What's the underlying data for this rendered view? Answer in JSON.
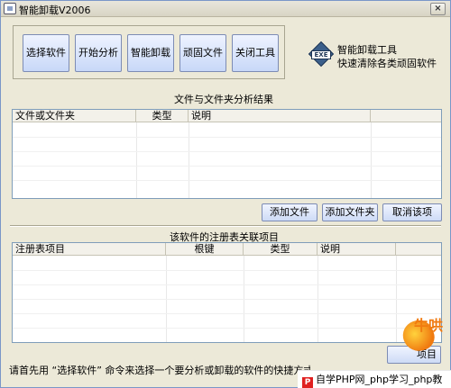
{
  "window": {
    "title": "智能卸载V2006",
    "close_label": "×"
  },
  "toolbar": {
    "buttons": [
      "选择软件",
      "开始分析",
      "智能卸载",
      "顽固文件",
      "关闭工具"
    ]
  },
  "logo": {
    "exe_label": "EXE",
    "line1": "智能卸载工具",
    "line2": "快速清除各类顽固软件"
  },
  "files_section": {
    "title": "文件与文件夹分析结果",
    "columns": [
      "文件或文件夹",
      "类型",
      "说明",
      ""
    ],
    "rows": []
  },
  "file_actions": {
    "add_file": "添加文件",
    "add_folder": "添加文件夹",
    "cancel": "取消该项"
  },
  "registry_section": {
    "title": "该软件的注册表关联项目",
    "columns": [
      "注册表项目",
      "根键",
      "类型",
      "说明",
      ""
    ],
    "rows": []
  },
  "registry_actions": {
    "partial_button": "项目"
  },
  "status": {
    "text": "请首先用 “选择软件” 命令来选择一个要分析或卸载的软件的快捷方式"
  },
  "watermark": {
    "brand": "牛哄",
    "site_text": "自学PHP网_php学习_php教"
  }
}
